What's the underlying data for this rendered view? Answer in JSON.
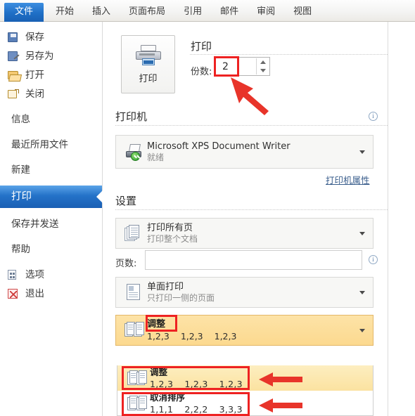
{
  "ribbon": {
    "tabs": [
      {
        "label": "文件",
        "active": true
      },
      {
        "label": "开始",
        "active": false
      },
      {
        "label": "插入",
        "active": false
      },
      {
        "label": "页面布局",
        "active": false
      },
      {
        "label": "引用",
        "active": false
      },
      {
        "label": "邮件",
        "active": false
      },
      {
        "label": "审阅",
        "active": false
      },
      {
        "label": "视图",
        "active": false
      }
    ]
  },
  "sidebar": {
    "items": [
      {
        "label": "保存",
        "icon": "save-icon",
        "selected": false
      },
      {
        "label": "另存为",
        "icon": "save-as-icon",
        "selected": false
      },
      {
        "label": "打开",
        "icon": "open-folder-icon",
        "selected": false
      },
      {
        "label": "关闭",
        "icon": "close-folder-icon",
        "selected": false
      },
      {
        "label": "信息",
        "icon": "",
        "selected": false
      },
      {
        "label": "最近所用文件",
        "icon": "",
        "selected": false
      },
      {
        "label": "新建",
        "icon": "",
        "selected": false
      },
      {
        "label": "打印",
        "icon": "",
        "selected": true
      },
      {
        "label": "保存并发送",
        "icon": "",
        "selected": false
      },
      {
        "label": "帮助",
        "icon": "",
        "selected": false
      },
      {
        "label": "选项",
        "icon": "options-icon",
        "selected": false
      },
      {
        "label": "退出",
        "icon": "exit-icon",
        "selected": false
      }
    ]
  },
  "main": {
    "print_button": {
      "label": "打印",
      "icon": "printer-icon"
    },
    "print_section": {
      "title": "打印",
      "copies_label": "份数:",
      "copies_value": "2"
    },
    "printer_section": {
      "title": "打印机",
      "info_icon": "info-icon",
      "selected_printer": {
        "name": "Microsoft XPS Document Writer",
        "status": "就绪",
        "icon": "printer-ready-icon"
      },
      "properties_link": "打印机属性"
    },
    "settings_section": {
      "title": "设置",
      "print_range": {
        "title": "打印所有页",
        "subtitle": "打印整个文档",
        "icon": "pages-stack-icon"
      },
      "pages_label": "页数:",
      "pages_value": "",
      "pages_placeholder": "",
      "pages_info_icon": "info-icon",
      "sided": {
        "title": "单面打印",
        "subtitle": "只打印一侧的页面",
        "icon": "single-sided-icon"
      },
      "collate": {
        "title": "调整",
        "sequence": [
          "1,2,3",
          "1,2,3",
          "1,2,3"
        ],
        "icon": "collate-icon",
        "highlighted": true
      },
      "collate_dropdown": {
        "options": [
          {
            "title": "调整",
            "sequence": [
              "1,2,3",
              "1,2,3",
              "1,2,3"
            ],
            "icon": "collate-icon",
            "hovered": true
          },
          {
            "title": "取消排序",
            "sequence": [
              "1,1,1",
              "2,2,2",
              "3,3,3"
            ],
            "icon": "uncollate-icon",
            "hovered": false
          }
        ]
      }
    }
  },
  "annotations": {
    "highlight_color": "#ee2222",
    "arrow_color": "#e8342a",
    "boxes": [
      {
        "name": "copies-value-box"
      },
      {
        "name": "collate-title-box"
      },
      {
        "name": "collate-option-1-box"
      },
      {
        "name": "collate-option-2-box"
      }
    ],
    "arrows": [
      {
        "name": "copies-arrow"
      },
      {
        "name": "collate-option-1-arrow"
      },
      {
        "name": "collate-option-2-arrow"
      }
    ]
  }
}
